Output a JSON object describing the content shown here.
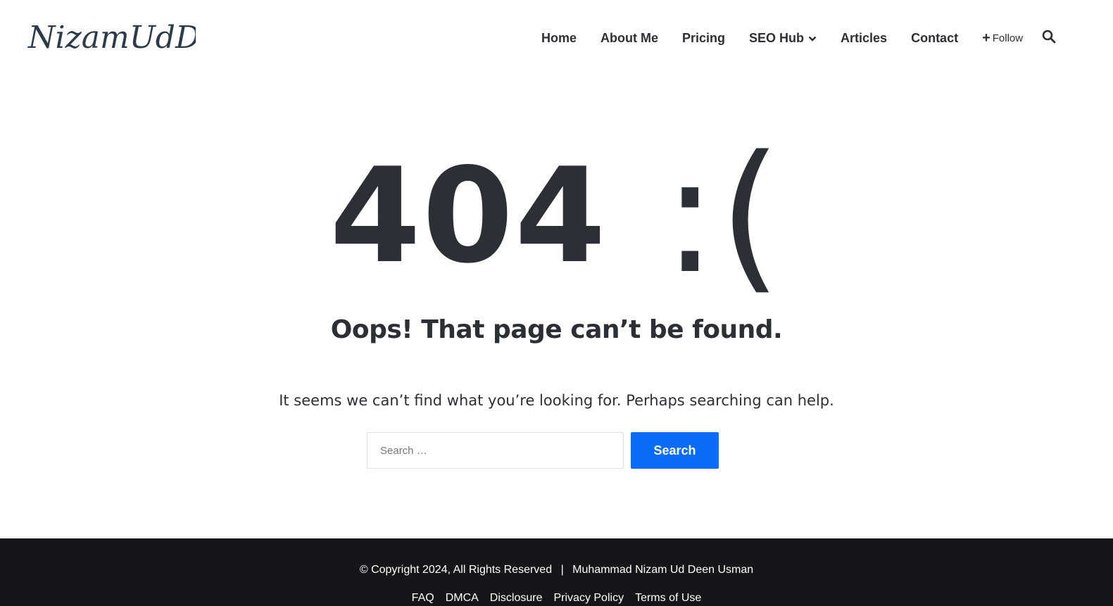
{
  "site": {
    "logo_text": "NizamUdDeen"
  },
  "nav": {
    "items": [
      {
        "label": "Home"
      },
      {
        "label": "About Me"
      },
      {
        "label": "Pricing"
      },
      {
        "label": "SEO Hub",
        "has_dropdown": true
      },
      {
        "label": "Articles"
      },
      {
        "label": "Contact"
      }
    ],
    "follow_label": "Follow",
    "icons": {
      "follow": "plus-icon",
      "dropdown": "chevron-down-icon",
      "search": "search-icon"
    }
  },
  "error": {
    "code": "404",
    "face": ":(",
    "title": "Oops! That page can’t be found.",
    "message": "It seems we can’t find what you’re looking for. Perhaps searching can help."
  },
  "search": {
    "placeholder": "Search …",
    "button_label": "Search"
  },
  "footer": {
    "copyright": "© Copyright 2024, All Rights Reserved",
    "separator": "|",
    "owner": "Muhammad Nizam Ud Deen Usman",
    "links": [
      "FAQ",
      "DMCA",
      "Disclosure",
      "Privacy Policy",
      "Terms of Use"
    ]
  },
  "colors": {
    "text": "#2c2f34",
    "accent": "#0a6cf6",
    "footer_bg": "#161619"
  }
}
